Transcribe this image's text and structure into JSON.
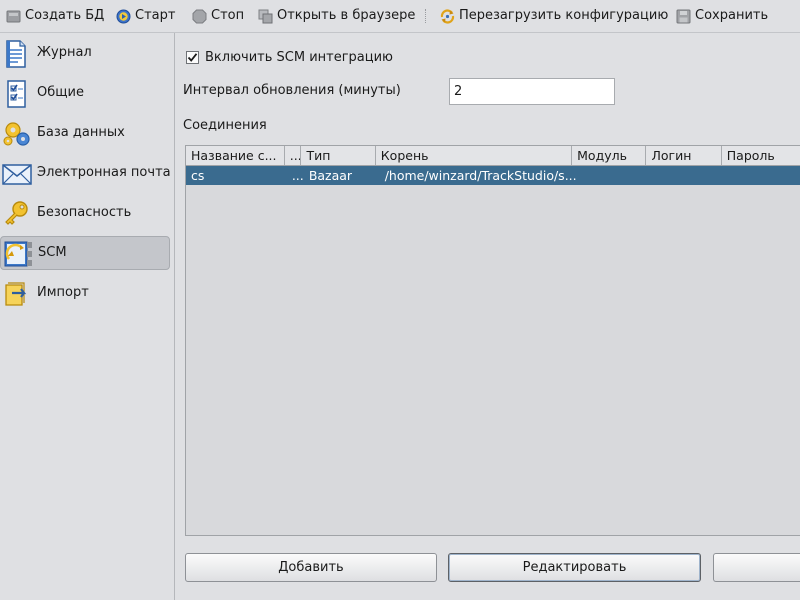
{
  "toolbar": {
    "create_db": "Создать БД",
    "start": "Старт",
    "stop": "Стоп",
    "open_browser": "Открыть в браузере",
    "reload_config": "Перезагрузить конфигурацию",
    "save": "Сохранить"
  },
  "sidebar": {
    "items": [
      {
        "label": "Журнал",
        "icon": "journal-icon"
      },
      {
        "label": "Общие",
        "icon": "checklist-icon"
      },
      {
        "label": "База данных",
        "icon": "gears-icon"
      },
      {
        "label": "Электронная почта",
        "icon": "envelope-icon"
      },
      {
        "label": "Безопасность",
        "icon": "key-icon"
      },
      {
        "label": "SCM",
        "icon": "scm-icon",
        "selected": true
      },
      {
        "label": "Импорт",
        "icon": "import-icon"
      }
    ]
  },
  "main": {
    "enable_scm_label": "Включить SCM интеграцию",
    "enable_scm_checked": true,
    "interval_label": "Интервал обновления (минуты)",
    "interval_value": "2",
    "connections_label": "Соединения",
    "table": {
      "columns": [
        "Название с...",
        "...",
        "Тип",
        "Корень",
        "Модуль",
        "Логин",
        "Пароль"
      ],
      "rows": [
        [
          "cs",
          "...",
          "Bazaar",
          "/home/winzard/TrackStudio/s...",
          "",
          "",
          ""
        ]
      ]
    },
    "buttons": {
      "add": "Добавить",
      "edit": "Редактировать",
      "delete": ""
    }
  },
  "colors": {
    "background": "#dfe0e3",
    "selection": "#3a6b8f",
    "sidebar_selected": "#c4c6cb"
  }
}
